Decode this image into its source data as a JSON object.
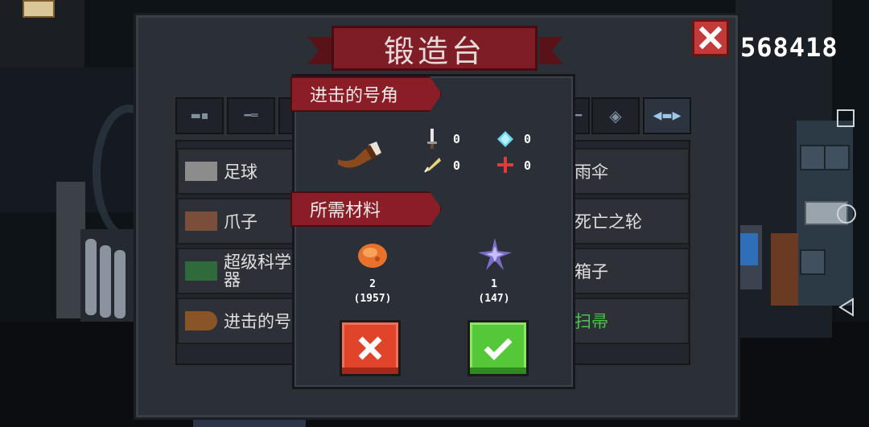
{
  "colors": {
    "panel": "#2b2f36",
    "ribbon": "#8a1d26",
    "cancel": "#e0452b",
    "confirm": "#55c83a",
    "green_text": "#4cc24c"
  },
  "header": {
    "title": "锻造台",
    "score": "568418"
  },
  "tabs": [
    {
      "icon": "pistol-icon"
    },
    {
      "icon": "rifle-icon"
    },
    {
      "icon": "shotgun-icon"
    },
    {
      "icon": "laser-icon"
    },
    {
      "icon": "crosshair-icon"
    },
    {
      "icon": "fish-icon"
    }
  ],
  "list_left": [
    {
      "label": "足球",
      "icon": "football-item-icon"
    },
    {
      "label": "爪子",
      "icon": "claw-item-icon"
    },
    {
      "label": "超级科学\n器",
      "icon": "science-item-icon"
    },
    {
      "label": "进击的号",
      "icon": "horn-item-icon"
    }
  ],
  "list_right": [
    {
      "label": "雨伞"
    },
    {
      "label": "死亡之轮"
    },
    {
      "label": "箱子"
    },
    {
      "label": "扫帚"
    }
  ],
  "popup": {
    "item_title": "进击的号角",
    "item_icon": "horn-icon",
    "stats": {
      "damage": "0",
      "energy": "0",
      "crit": "0",
      "precision": "0"
    },
    "materials_title": "所需材料",
    "materials": [
      {
        "icon": "ore-material-icon",
        "need": "2",
        "have": "(1957)"
      },
      {
        "icon": "crystal-material-icon",
        "need": "1",
        "have": "(147)"
      }
    ]
  }
}
